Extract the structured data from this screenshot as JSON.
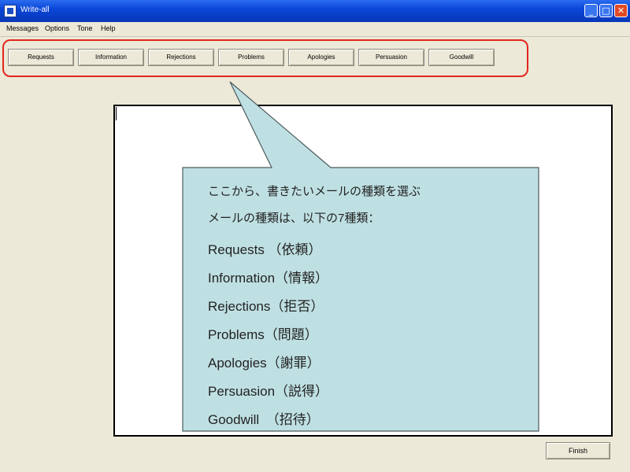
{
  "window": {
    "title": "Write-all"
  },
  "menu": [
    "Messages",
    "Options",
    "Tone",
    "Help"
  ],
  "toolbar": {
    "buttons": [
      "Requests",
      "Information",
      "Rejections",
      "Problems",
      "Apologies",
      "Persuasion",
      "Goodwill"
    ]
  },
  "callout": {
    "line1": "ここから、書きたいメールの種類を選ぶ",
    "line2": "メールの種類は、以下の7種類：",
    "items": [
      "Requests （依頼）",
      "Information（情報）",
      "Rejections（拒否）",
      "Problems（問題）",
      "Apologies（謝罪）",
      "Persuasion（説得）",
      "Goodwill　（招待）"
    ]
  },
  "finish_label": "Finish",
  "colors": {
    "highlight": "#e3261e",
    "callout_fill": "#bfe0e3",
    "titlebar": "#0a46d8"
  }
}
